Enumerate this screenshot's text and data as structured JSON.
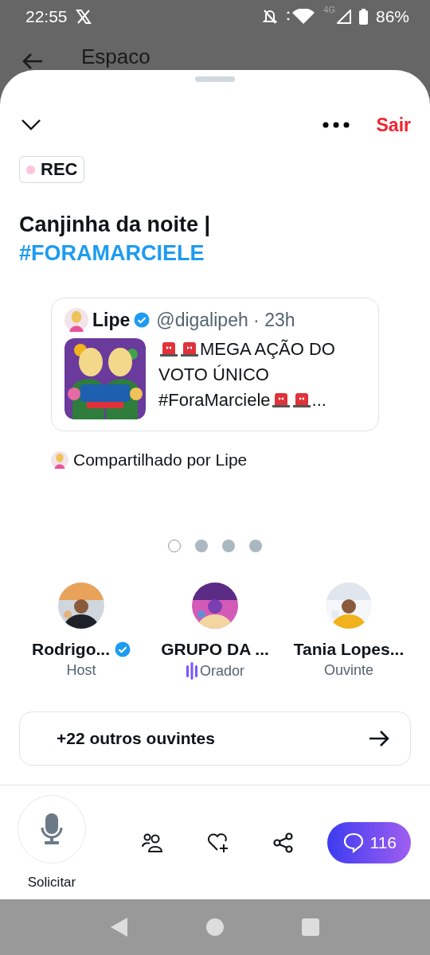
{
  "status_bar": {
    "time": "22:55",
    "battery": "86%",
    "network": "4G"
  },
  "background": {
    "title": "Espaco"
  },
  "sheet": {
    "leave": "Sair",
    "recording": {
      "label": "REC",
      "on": true
    },
    "title": "Canjinha da noite |",
    "hashtag": "#FORAMARCIELE",
    "tweet": {
      "author": "Lipe",
      "verified": true,
      "handle": "@digalipeh · 23h",
      "segments": [
        {
          "kind": "siren"
        },
        {
          "kind": "siren"
        },
        {
          "kind": "text",
          "text": "MEGA AÇÃO DO VOTO ÚNICO #ForaMarciele"
        },
        {
          "kind": "siren"
        },
        {
          "kind": "siren"
        },
        {
          "kind": "text",
          "text": "..."
        }
      ]
    },
    "shared_by": "Compartilhado por Lipe",
    "pager": [
      {
        "selected": true
      },
      {
        "selected": false
      },
      {
        "selected": false
      },
      {
        "selected": false
      }
    ],
    "participants": [
      {
        "name": "Rodrigo...",
        "verified": true,
        "speaking": false,
        "role": "Host"
      },
      {
        "name": "GRUPO DA ...",
        "verified": false,
        "speaking": true,
        "role": "Orador"
      },
      {
        "name": "Tania Lopes...",
        "verified": false,
        "speaking": false,
        "role": "Ouvinte"
      }
    ],
    "listeners": "+22 outros ouvintes",
    "request_label": "Solicitar",
    "comments": "116"
  }
}
